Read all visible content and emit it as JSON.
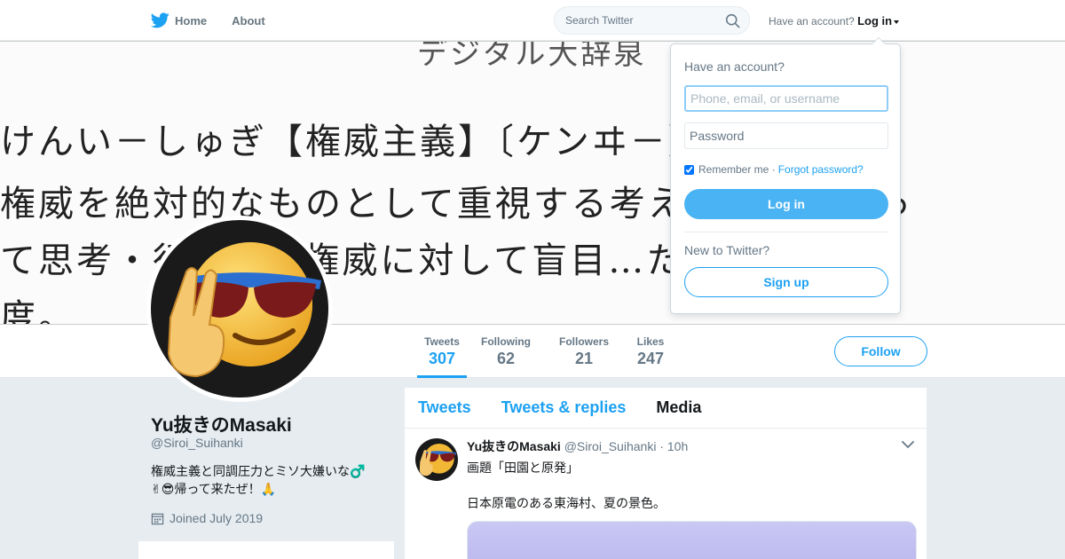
{
  "nav": {
    "home_label": "Home",
    "about_label": "About",
    "search_placeholder": "Search Twitter",
    "have_account": "Have an account?",
    "login_label": "Log in"
  },
  "banner": {
    "lines": [
      "デジタル大辞泉",
      "けんい－しゅぎ【権威主義】〔ケンヰ－〕",
      "権威を絶対的なものとして重視する考え方…てにとっ",
      "て思考・行…り、権威に対して盲目…たりする態",
      "度。"
    ]
  },
  "stats": {
    "tweets": {
      "label": "Tweets",
      "value": "307"
    },
    "following": {
      "label": "Following",
      "value": "62"
    },
    "followers": {
      "label": "Followers",
      "value": "21"
    },
    "likes": {
      "label": "Likes",
      "value": "247"
    }
  },
  "follow_label": "Follow",
  "profile": {
    "name": "Yu抜きのMasaki",
    "handle": "@Siroi_Suihanki",
    "bio_line1": "権威主義と同調圧力とミソ大嫌いな♂️",
    "bio_line2": "✌😎帰って来たぜ！🙏",
    "joined": "Joined July 2019"
  },
  "timeline": {
    "tabs": [
      "Tweets",
      "Tweets & replies",
      "Media"
    ],
    "tweet": {
      "name": "Yu抜きのMasaki",
      "handle": "@Siroi_Suihanki",
      "time": "· 10h",
      "line1": "画題「田園と原発」",
      "line2": "日本原電のある東海村、夏の景色。"
    }
  },
  "login_dropdown": {
    "title": "Have an account?",
    "username_placeholder": "Phone, email, or username",
    "password_placeholder": "Password",
    "remember": "Remember me ·",
    "forgot": "Forgot password?",
    "login_button": "Log in",
    "new_to": "New to Twitter?",
    "signup_button": "Sign up"
  },
  "colors": {
    "accent": "#1da1f2",
    "login_button": "#4ab3f4",
    "page_bg": "#e6ecf0"
  }
}
